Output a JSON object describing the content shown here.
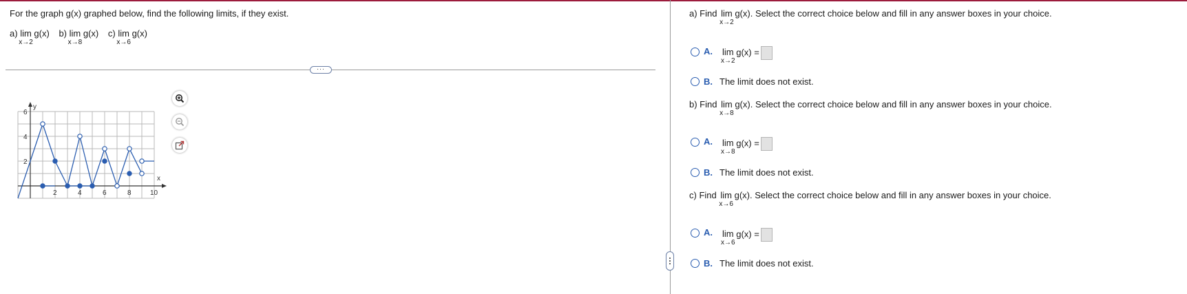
{
  "left": {
    "prompt": "For the graph g(x) graphed below, find the following limits, if they exist.",
    "parts": [
      {
        "label": "a)",
        "lim": "lim",
        "func": "g(x)",
        "approach": "x→2"
      },
      {
        "label": "b)",
        "lim": "lim",
        "func": "g(x)",
        "approach": "x→8"
      },
      {
        "label": "c)",
        "lim": "lim",
        "func": "g(x)",
        "approach": "x→6"
      }
    ],
    "divider_handle": "···"
  },
  "graph": {
    "ylabel": "y",
    "xlabel": "x",
    "xticks": [
      "2",
      "4",
      "6",
      "8",
      "10"
    ],
    "yticks": [
      "2",
      "4",
      "6"
    ],
    "xlim": [
      -1,
      10
    ],
    "ylim": [
      -1,
      6
    ],
    "line_color": "#2a5db0",
    "segments": [
      [
        [
          -1,
          -1
        ],
        [
          1,
          5
        ]
      ],
      [
        [
          1,
          5
        ],
        [
          2,
          2
        ]
      ],
      [
        [
          2,
          2
        ],
        [
          3,
          0
        ]
      ],
      [
        [
          3,
          0
        ],
        [
          4,
          4
        ]
      ],
      [
        [
          4,
          4
        ],
        [
          5,
          0
        ]
      ],
      [
        [
          5,
          0
        ],
        [
          6,
          3
        ]
      ],
      [
        [
          6,
          3
        ],
        [
          7,
          0
        ]
      ],
      [
        [
          7,
          0
        ],
        [
          8,
          3
        ]
      ],
      [
        [
          8,
          3
        ],
        [
          9,
          1
        ]
      ],
      [
        [
          9,
          2
        ],
        [
          10,
          2
        ]
      ]
    ],
    "open_points": [
      [
        1,
        5
      ],
      [
        4,
        4
      ],
      [
        6,
        3
      ],
      [
        7,
        0
      ],
      [
        8,
        3
      ],
      [
        9,
        2
      ],
      [
        9,
        1
      ]
    ],
    "closed_points": [
      [
        1,
        0
      ],
      [
        2,
        2
      ],
      [
        3,
        0
      ],
      [
        4,
        0
      ],
      [
        5,
        0
      ],
      [
        6,
        2
      ],
      [
        8,
        1
      ]
    ],
    "closed_flat": [
      [
        [
          1,
          0
        ],
        [
          2,
          0
        ]
      ],
      [
        [
          3,
          0
        ],
        [
          5,
          0
        ]
      ]
    ]
  },
  "tools": {
    "zoom_in": "zoom-in-icon",
    "zoom_out": "zoom-out-icon",
    "popout": "popout-icon"
  },
  "right": {
    "questions": [
      {
        "find": "a) Find",
        "lim": "lim",
        "func": "g(x).",
        "rest": "Select the correct choice below and fill in any answer boxes in your choice.",
        "approach": "x→2",
        "optA_letter": "A.",
        "optA_lim": "lim",
        "optA_func": "g(x) =",
        "optB_letter": "B.",
        "optB_text": "The limit does not exist."
      },
      {
        "find": "b) Find",
        "lim": "lim",
        "func": "g(x).",
        "rest": "Select the correct choice below and fill in any answer boxes in your choice.",
        "approach": "x→8",
        "optA_letter": "A.",
        "optA_lim": "lim",
        "optA_func": "g(x) =",
        "optB_letter": "B.",
        "optB_text": "The limit does not exist."
      },
      {
        "find": "c) Find",
        "lim": "lim",
        "func": "g(x).",
        "rest": "Select the correct choice below and fill in any answer boxes in your choice.",
        "approach": "x→6",
        "optA_letter": "A.",
        "optA_lim": "lim",
        "optA_func": "g(x) =",
        "optB_letter": "B.",
        "optB_text": "The limit does not exist."
      }
    ]
  }
}
